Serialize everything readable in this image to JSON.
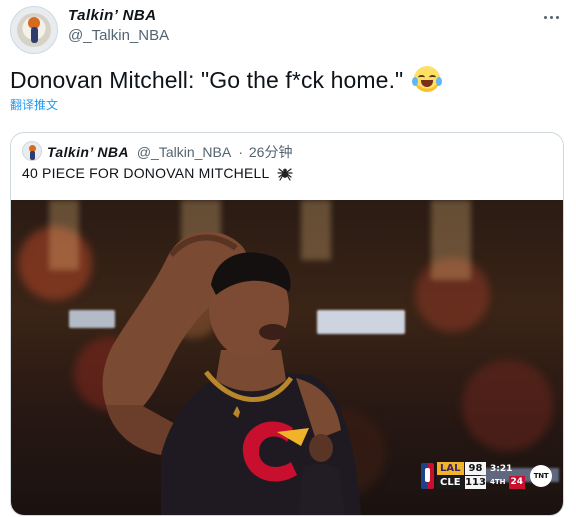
{
  "tweet": {
    "display_name": "Talkin’ NBA",
    "handle": "@_Talkin_NBA",
    "text": "Donovan Mitchell: \"Go the f*ck home.\"",
    "emoji_icon": "face-with-tears-of-joy-icon",
    "translate_link": "翻译推文",
    "more_icon": "more-options-icon"
  },
  "quoted_tweet": {
    "display_name": "Talkin’ NBA",
    "handle": "@_Talkin_NBA",
    "separator": "·",
    "time": "26分钟",
    "text": "40 PIECE FOR DONOVAN MITCHELL",
    "trailing_icon": "spider-icon"
  },
  "scorebug": {
    "away_code": "LAL",
    "away_score": "98",
    "home_code": "CLE",
    "home_score": "113",
    "game_clock": "3:21",
    "period": "4TH",
    "shot_clock": "24",
    "network": "TNT",
    "colors": {
      "away": "#f0b428",
      "home": "#1a1a1a",
      "shot_clock": "#c8102e"
    }
  },
  "colors": {
    "link": "#1d9bf0",
    "secondary_text": "#536471",
    "border": "#cfd9de"
  }
}
